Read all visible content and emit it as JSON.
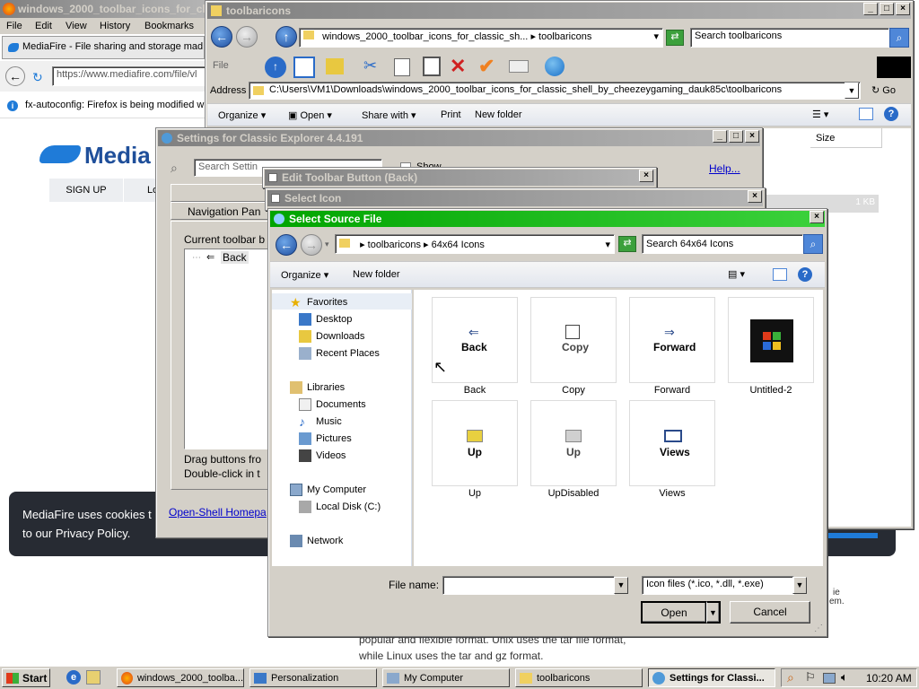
{
  "firefox": {
    "title": "windows_2000_toolbar_icons_for_cl",
    "menu": [
      "File",
      "Edit",
      "View",
      "History",
      "Bookmarks"
    ],
    "tab": "MediaFire - File sharing and storage mad...",
    "url": "https://www.mediafire.com/file/vl",
    "notice": "fx-autoconfig: Firefox is being modified w",
    "logo": "Media",
    "signup": "SIGN UP",
    "login": "Lo",
    "cookie_line1": "MediaFire uses cookies t",
    "cookie_line2": "to our Privacy Policy.",
    "body_line1": "popular and flexible format. Unix uses the tar file format,",
    "body_line2": "while Linux uses the tar and gz format.",
    "side_frag1": "ie",
    "side_frag2": "em."
  },
  "explorer": {
    "title": "toolbaricons",
    "path_crumb1": "windows_2000_toolbar_icons_for_classic_sh...",
    "path_crumb2": "toolbaricons",
    "search_placeholder": "Search toolbaricons",
    "file_menu": "File",
    "address_label": "Address",
    "address": "C:\\Users\\VM1\\Downloads\\windows_2000_toolbar_icons_for_classic_shell_by_cheezeygaming_dauk85c\\toolbaricons",
    "go": "Go",
    "cmd": [
      "Organize",
      "Open",
      "Share with",
      "Print",
      "New folder"
    ],
    "col_size": "Size",
    "size_value": "1 KB"
  },
  "settings": {
    "title": "Settings for Classic Explorer 4.4.191",
    "search_placeholder": "Search Settin",
    "show_all": "Show all settings",
    "help": "Help...",
    "tab_file": "File",
    "tab_nav": "Navigation Pan",
    "current_toolbar": "Current toolbar b",
    "tree_item": "Back",
    "drag_hint1": "Drag buttons fro",
    "drag_hint2": "Double-click in t",
    "homepage": "Open-Shell Homepa"
  },
  "edit_button": {
    "title": "Edit Toolbar Button (Back)"
  },
  "select_icon": {
    "title": "Select Icon"
  },
  "dialog": {
    "title": "Select Source File",
    "crumb1": "toolbaricons",
    "crumb2": "64x64 Icons",
    "search_placeholder": "Search 64x64 Icons",
    "organize": "Organize",
    "new_folder": "New folder",
    "nav": {
      "favorites": "Favorites",
      "desktop": "Desktop",
      "downloads": "Downloads",
      "recent": "Recent Places",
      "libraries": "Libraries",
      "documents": "Documents",
      "music": "Music",
      "pictures": "Pictures",
      "videos": "Videos",
      "computer": "My Computer",
      "localdisk": "Local Disk (C:)",
      "network": "Network"
    },
    "files": [
      {
        "name": "Back",
        "glyph": "Back"
      },
      {
        "name": "Copy",
        "glyph": "Copy"
      },
      {
        "name": "Forward",
        "glyph": "Forward"
      },
      {
        "name": "Untitled-2",
        "glyph": ""
      },
      {
        "name": "Up",
        "glyph": "Up"
      },
      {
        "name": "UpDisabled",
        "glyph": "Up"
      },
      {
        "name": "Views",
        "glyph": "Views"
      }
    ],
    "filename_label": "File name:",
    "filename_value": "",
    "filter": "Icon files (*.ico, *.dll, *.exe)",
    "open": "Open",
    "cancel": "Cancel"
  },
  "taskbar": {
    "start": "Start",
    "tasks": [
      "windows_2000_toolba...",
      "Personalization",
      "My Computer",
      "toolbaricons",
      "Settings for Classi..."
    ],
    "clock": "10:20 AM"
  }
}
